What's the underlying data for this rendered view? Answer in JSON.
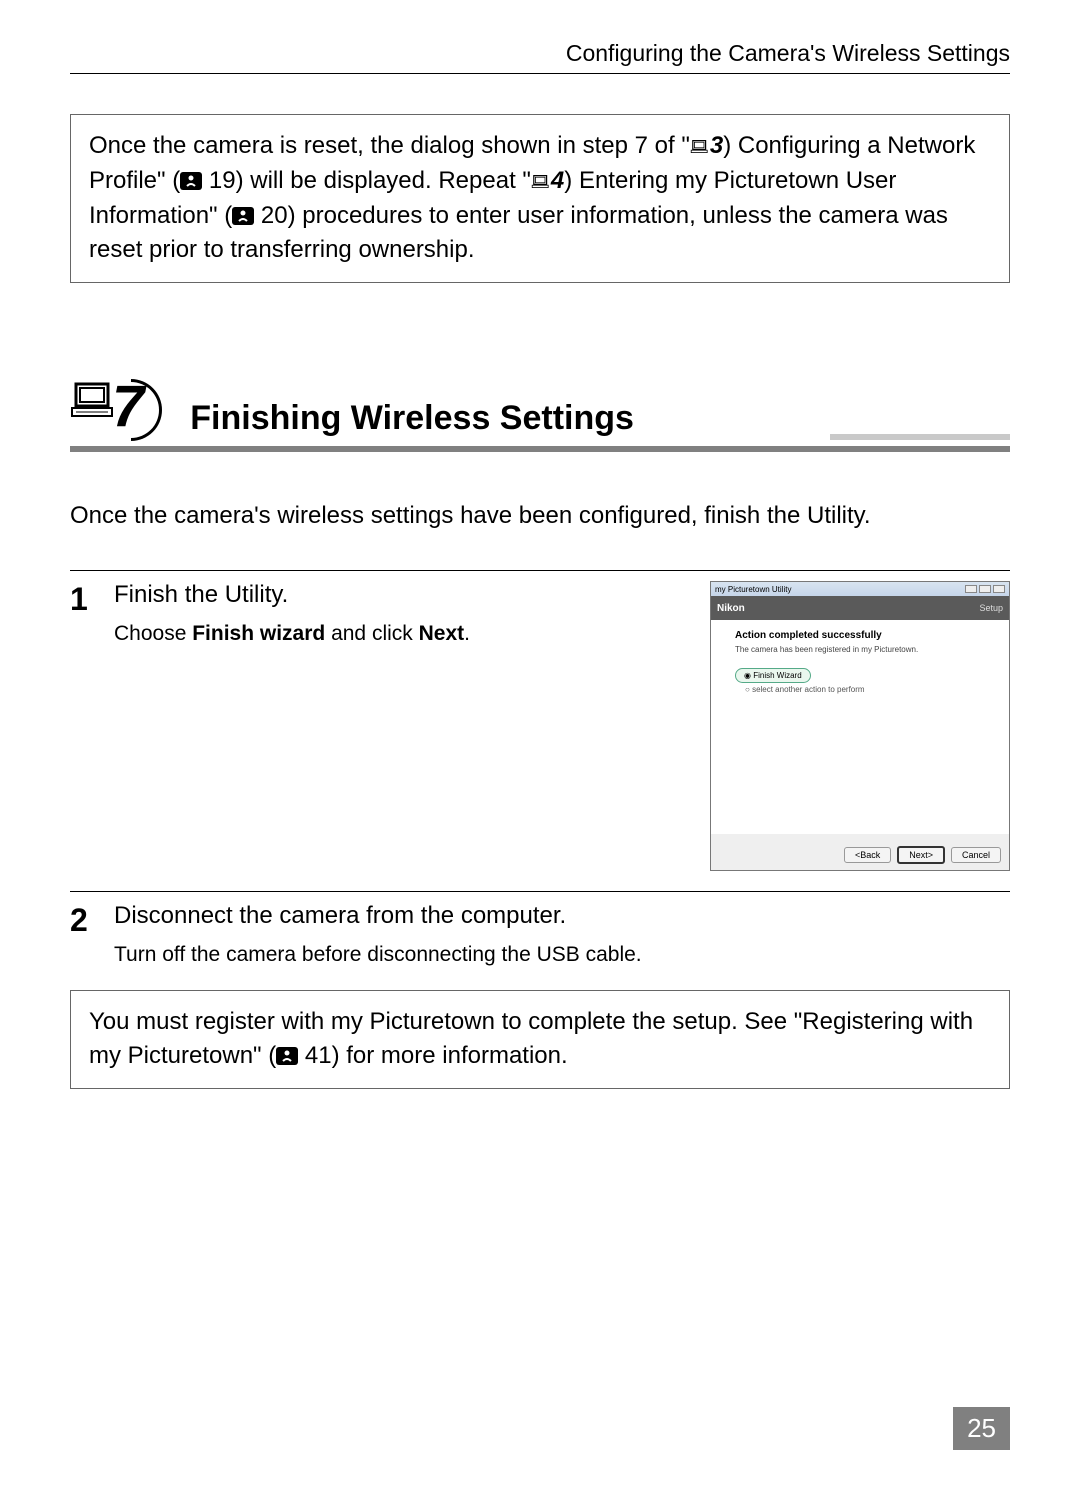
{
  "header": {
    "section_path": "Configuring the Camera's Wireless Settings"
  },
  "note1": {
    "part1": "Once the camera is reset, the dialog shown in step 7 of \"",
    "ref3": "3",
    "part2": " Configuring a Network Profile\" (",
    "page19": " 19) will be displayed. Repeat \"",
    "ref4": "4",
    "part3": " Entering my Picturetown User Information\" (",
    "page20": " 20) procedures to enter user information, unless the camera was reset prior to transferring ownership."
  },
  "section": {
    "number": "7",
    "title": "Finishing Wireless Settings"
  },
  "intro": "Once the camera's wireless settings have been configured, finish the Utility.",
  "steps": [
    {
      "num": "1",
      "title": "Finish the Utility.",
      "desc_pre": "Choose ",
      "desc_bold1": "Finish wizard",
      "desc_mid": " and click ",
      "desc_bold2": "Next",
      "desc_post": "."
    },
    {
      "num": "2",
      "title": "Disconnect the camera from the computer.",
      "desc": "Turn off the camera before disconnecting the USB cable."
    }
  ],
  "dialog": {
    "window_title": "my Picturetown Utility",
    "brand": "Nikon",
    "setup_label": "Setup",
    "heading": "Action completed successfully",
    "subtext": "The camera has been registered in my Picturetown.",
    "radio_selected": "Finish Wizard",
    "radio_unselected": "select another action to perform",
    "btn_back": "<Back",
    "btn_next": "Next>",
    "btn_cancel": "Cancel"
  },
  "note2": {
    "part1": "You must register with my Picturetown to complete the setup. See \"Registering with my Picturetown\" (",
    "page41": " 41) for more information."
  },
  "page_number": "25"
}
